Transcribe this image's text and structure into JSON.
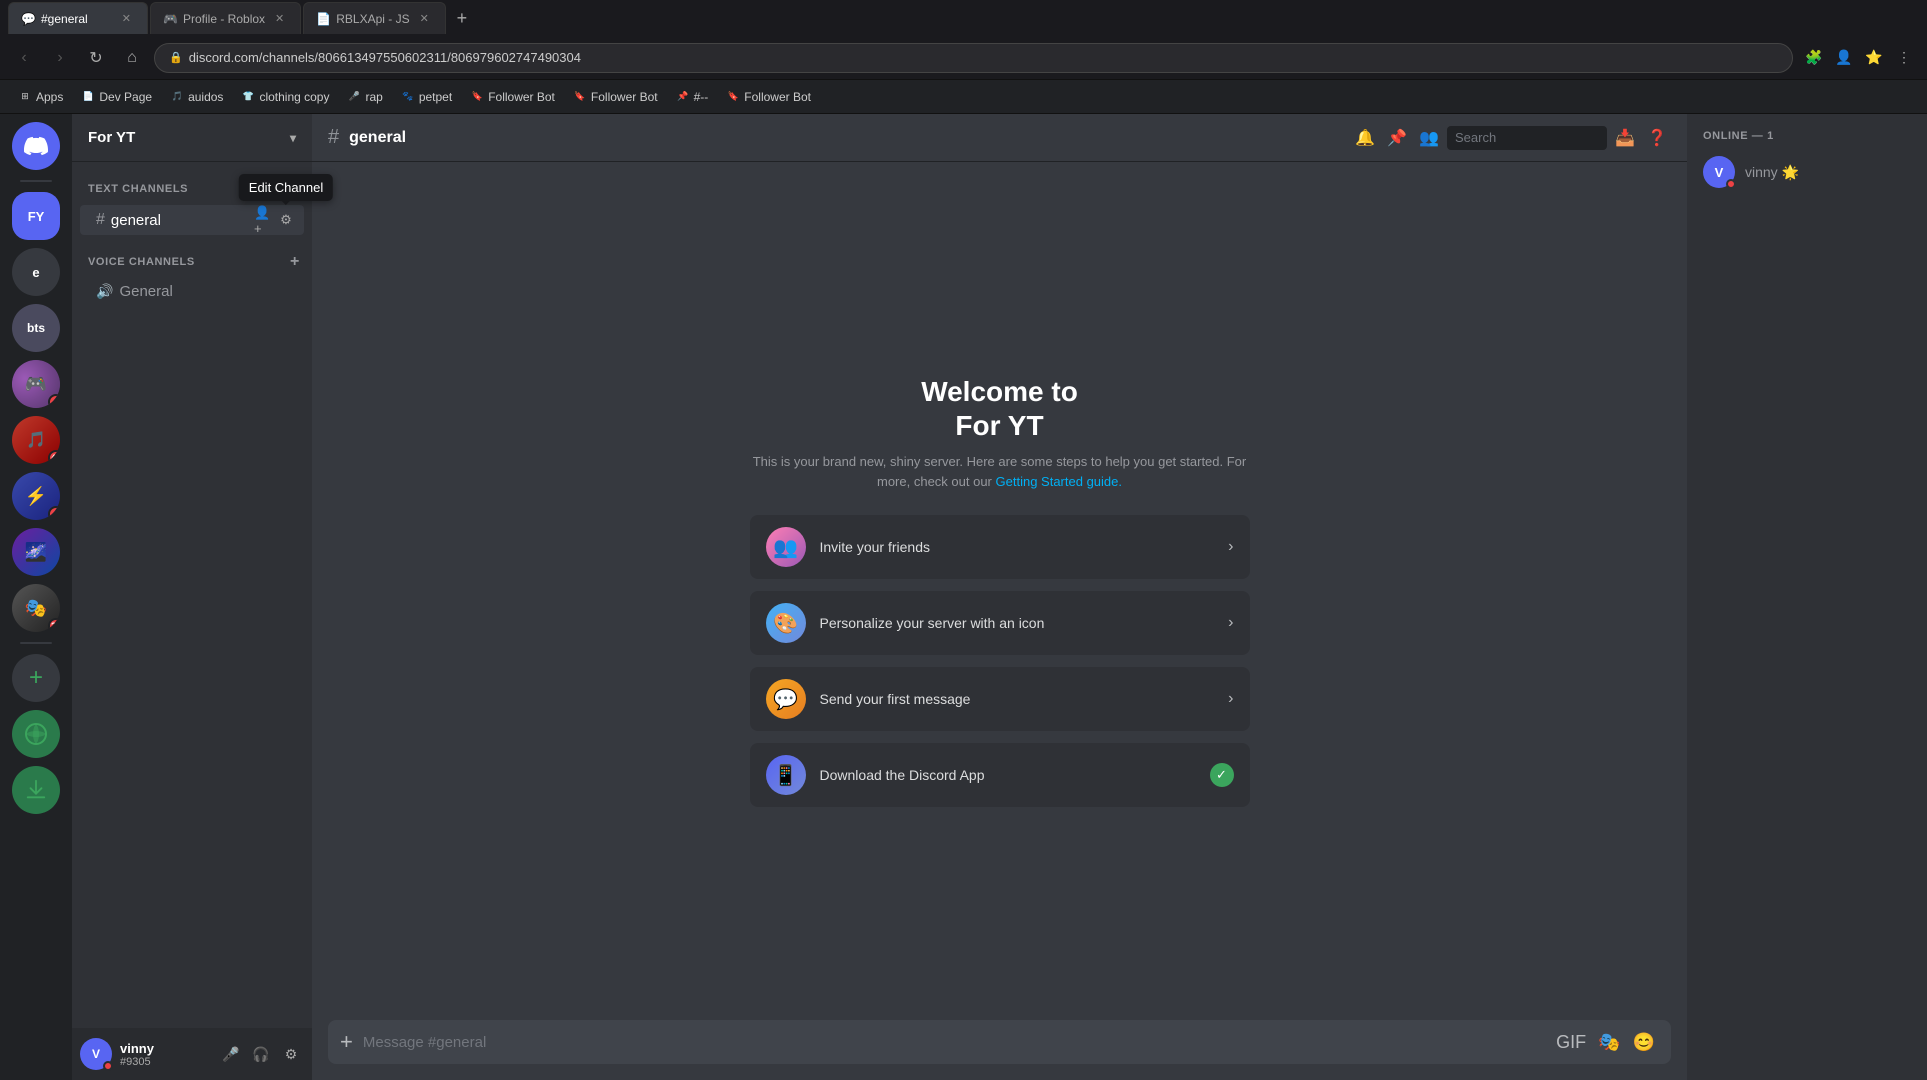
{
  "browser": {
    "tabs": [
      {
        "id": "tab1",
        "title": "Profile - Roblox",
        "favicon": "🎮",
        "active": false,
        "url": ""
      },
      {
        "id": "tab2",
        "title": "#general",
        "favicon": "💬",
        "active": true,
        "url": "discord.com/channels/806613497550602311/806979602747490304"
      },
      {
        "id": "tab3",
        "title": "RBLXApi - JS",
        "favicon": "📄",
        "active": false,
        "url": ""
      }
    ],
    "new_tab_icon": "+",
    "url": "discord.com/channels/806613497550602311/806979602747490304",
    "nav": {
      "back": "‹",
      "forward": "›",
      "reload": "↻",
      "home": "⌂"
    },
    "bookmarks": [
      {
        "id": "bm1",
        "title": "Apps",
        "favicon": "⊞"
      },
      {
        "id": "bm2",
        "title": "Dev Page",
        "favicon": "📄"
      },
      {
        "id": "bm3",
        "title": "auidos",
        "favicon": "🎵"
      },
      {
        "id": "bm4",
        "title": "clothing copy",
        "favicon": "👕"
      },
      {
        "id": "bm5",
        "title": "rap",
        "favicon": "🎤"
      },
      {
        "id": "bm6",
        "title": "petpet",
        "favicon": "🐾"
      },
      {
        "id": "bm7",
        "title": "Follower Bot",
        "favicon": "🔖"
      },
      {
        "id": "bm8",
        "title": "Follower Bot",
        "favicon": "🔖"
      },
      {
        "id": "bm9",
        "title": "#--",
        "favicon": "📌"
      },
      {
        "id": "bm10",
        "title": "Follower Bot",
        "favicon": "🔖"
      }
    ]
  },
  "discord": {
    "servers": [
      {
        "id": "home",
        "label": "🏠",
        "type": "home",
        "active": false
      },
      {
        "id": "fy",
        "label": "FY",
        "color": "#5865f2",
        "active": true,
        "badge": null
      },
      {
        "id": "e",
        "label": "e",
        "color": "#36393f",
        "active": false
      },
      {
        "id": "bts",
        "label": "bts",
        "color": "#4a4a5e",
        "active": false
      }
    ],
    "server_name": "For YT",
    "channel_groups": [
      {
        "id": "text",
        "label": "TEXT CHANNELS",
        "channels": [
          {
            "id": "general",
            "name": "general",
            "type": "text",
            "active": true
          }
        ]
      },
      {
        "id": "voice",
        "label": "VOICE CHANNELS",
        "channels": [
          {
            "id": "general-voice",
            "name": "General",
            "type": "voice",
            "active": false
          }
        ]
      }
    ],
    "current_channel": "#general",
    "channel_header_name": "general",
    "welcome": {
      "title_line1": "Welcome to",
      "title_line2": "For YT",
      "subtitle": "This is your brand new, shiny server. Here are some steps to help you get started. For more, check out our",
      "subtitle_link": "Getting Started guide.",
      "actions": [
        {
          "id": "invite",
          "label": "Invite your friends",
          "icon_type": "invite",
          "icon_emoji": "👥",
          "completed": false
        },
        {
          "id": "personalize",
          "label": "Personalize your server with an icon",
          "icon_type": "personalize",
          "icon_emoji": "🎨",
          "completed": false
        },
        {
          "id": "message",
          "label": "Send your first message",
          "icon_type": "message",
          "icon_emoji": "💬",
          "completed": false
        },
        {
          "id": "download",
          "label": "Download the Discord App",
          "icon_type": "download",
          "icon_emoji": "📱",
          "completed": true
        }
      ]
    },
    "message_placeholder": "Message #general",
    "user": {
      "name": "vinny",
      "tag": "#9305",
      "avatar_text": "V",
      "status": "dnd"
    },
    "online_section": "ONLINE — 1",
    "members": [
      {
        "id": "vinny",
        "name": "vinny",
        "avatar_text": "V",
        "avatar_color": "#5865f2",
        "status": "dnd",
        "badge": "🌟"
      }
    ],
    "edit_channel_tooltip": "Edit Channel",
    "header_actions": {
      "bell": "🔔",
      "pin": "📌",
      "members": "👥",
      "search_placeholder": "Search"
    }
  }
}
